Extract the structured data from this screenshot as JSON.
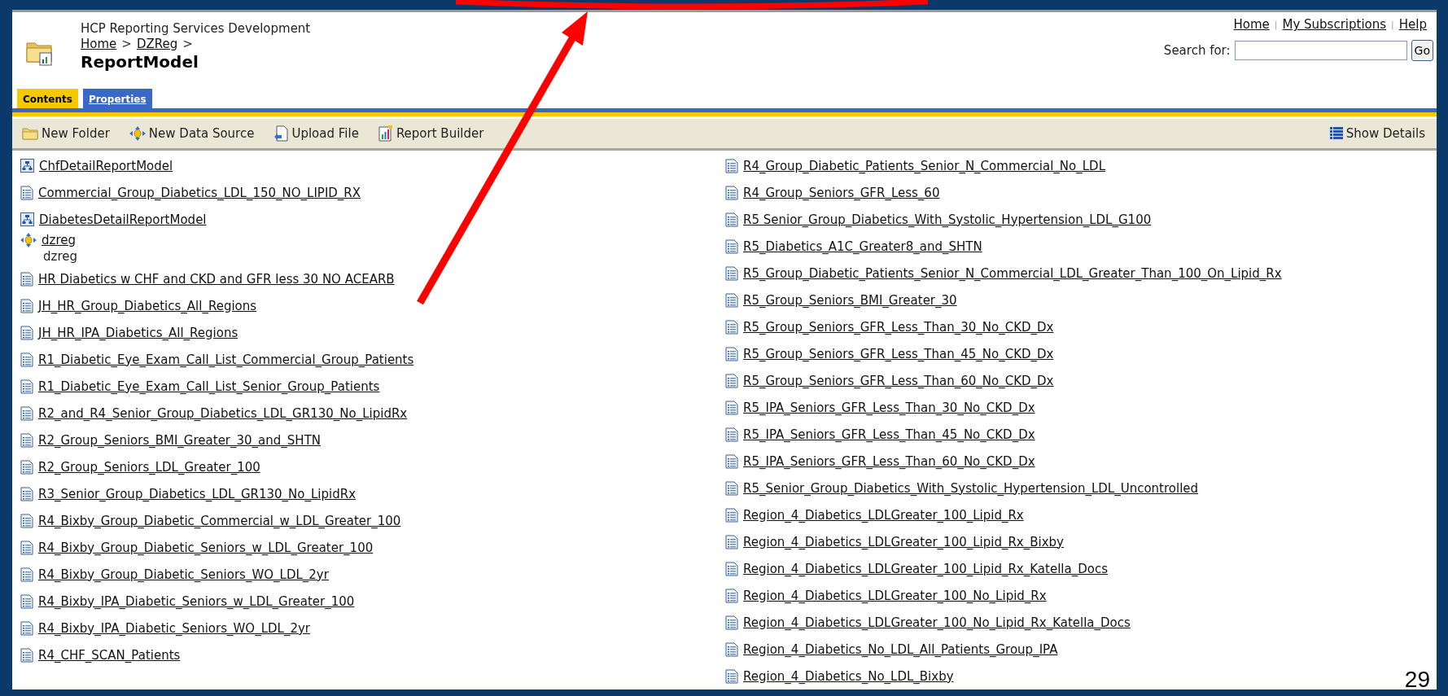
{
  "header": {
    "site_title": "HCP Reporting Services Development",
    "breadcrumb": [
      {
        "label": "Home",
        "separator": ">"
      },
      {
        "label": "DZReg",
        "separator": ">"
      }
    ],
    "page_title": "ReportModel"
  },
  "top_links": [
    {
      "label": "Home",
      "separator": "|"
    },
    {
      "label": "My Subscriptions",
      "separator": "|"
    },
    {
      "label": "Help"
    }
  ],
  "search": {
    "label": "Search for:",
    "button": "Go"
  },
  "tabs": [
    {
      "label": "Contents",
      "selected": true
    },
    {
      "label": "Properties",
      "selected": false
    }
  ],
  "toolbar": {
    "actions": [
      {
        "label": "New Folder",
        "kind": "folder"
      },
      {
        "label": "New Data Source",
        "kind": "datasource"
      },
      {
        "label": "Upload File",
        "kind": "upload"
      },
      {
        "label": "Report Builder",
        "kind": "builder"
      }
    ],
    "show_details": "Show Details"
  },
  "left_column": [
    {
      "name": "ChfDetailReportModel",
      "kind": "model"
    },
    {
      "name": "Commercial_Group_Diabetics_LDL_150_NO_LIPID_RX",
      "kind": "report"
    },
    {
      "name": "DiabetesDetailReportModel",
      "kind": "model"
    },
    {
      "name": "dzreg",
      "kind": "datasource",
      "description": "dzreg"
    },
    {
      "name": "HR Diabetics w CHF and CKD and GFR less 30 NO ACEARB",
      "kind": "report"
    },
    {
      "name": "JH_HR_Group_Diabetics_All_Regions",
      "kind": "report"
    },
    {
      "name": "JH_HR_IPA_Diabetics_All_Regions",
      "kind": "report"
    },
    {
      "name": "R1_Diabetic_Eye_Exam_Call_List_Commercial_Group_Patients",
      "kind": "report"
    },
    {
      "name": "R1_Diabetic_Eye_Exam_Call_List_Senior_Group_Patients",
      "kind": "report"
    },
    {
      "name": "R2_and_R4_Senior_Group_Diabetics_LDL_GR130_No_LipidRx",
      "kind": "report"
    },
    {
      "name": "R2_Group_Seniors_BMI_Greater_30_and_SHTN",
      "kind": "report"
    },
    {
      "name": "R2_Group_Seniors_LDL_Greater_100",
      "kind": "report"
    },
    {
      "name": "R3_Senior_Group_Diabetics_LDL_GR130_No_LipidRx",
      "kind": "report"
    },
    {
      "name": "R4_Bixby_Group_Diabetic_Commercial_w_LDL_Greater_100",
      "kind": "report"
    },
    {
      "name": "R4_Bixby_Group_Diabetic_Seniors_w_LDL_Greater_100",
      "kind": "report"
    },
    {
      "name": "R4_Bixby_Group_Diabetic_Seniors_WO_LDL_2yr",
      "kind": "report"
    },
    {
      "name": "R4_Bixby_IPA_Diabetic_Seniors_w_LDL_Greater_100",
      "kind": "report"
    },
    {
      "name": "R4_Bixby_IPA_Diabetic_Seniors_WO_LDL_2yr",
      "kind": "report"
    },
    {
      "name": "R4_CHF_SCAN_Patients",
      "kind": "report"
    }
  ],
  "right_column": [
    {
      "name": "R4_Group_Diabetic_Patients_Senior_N_Commercial_No_LDL",
      "kind": "report"
    },
    {
      "name": "R4_Group_Seniors_GFR_Less_60",
      "kind": "report"
    },
    {
      "name": "R5 Senior_Group_Diabetics_With_Systolic_Hypertension_LDL_G100",
      "kind": "report"
    },
    {
      "name": "R5_Diabetics_A1C_Greater8_and_SHTN",
      "kind": "report"
    },
    {
      "name": "R5_Group_Diabetic_Patients_Senior_N_Commercial_LDL_Greater_Than_100_On_Lipid_Rx",
      "kind": "report"
    },
    {
      "name": "R5_Group_Seniors_BMI_Greater_30",
      "kind": "report"
    },
    {
      "name": "R5_Group_Seniors_GFR_Less_Than_30_No_CKD_Dx",
      "kind": "report"
    },
    {
      "name": "R5_Group_Seniors_GFR_Less_Than_45_No_CKD_Dx",
      "kind": "report"
    },
    {
      "name": "R5_Group_Seniors_GFR_Less_Than_60_No_CKD_Dx",
      "kind": "report"
    },
    {
      "name": "R5_IPA_Seniors_GFR_Less_Than_30_No_CKD_Dx",
      "kind": "report"
    },
    {
      "name": "R5_IPA_Seniors_GFR_Less_Than_45_No_CKD_Dx",
      "kind": "report"
    },
    {
      "name": "R5_IPA_Seniors_GFR_Less_Than_60_No_CKD_Dx",
      "kind": "report"
    },
    {
      "name": "R5_Senior_Group_Diabetics_With_Systolic_Hypertension_LDL_Uncontrolled",
      "kind": "report"
    },
    {
      "name": "Region_4_Diabetics_LDLGreater_100_Lipid_Rx",
      "kind": "report"
    },
    {
      "name": "Region_4_Diabetics_LDLGreater_100_Lipid_Rx_Bixby",
      "kind": "report"
    },
    {
      "name": "Region_4_Diabetics_LDLGreater_100_Lipid_Rx_Katella_Docs",
      "kind": "report"
    },
    {
      "name": "Region_4_Diabetics_LDLGreater_100_No_Lipid_Rx",
      "kind": "report"
    },
    {
      "name": "Region_4_Diabetics_LDLGreater_100_No_Lipid_Rx_Katella_Docs",
      "kind": "report"
    },
    {
      "name": "Region_4_Diabetics_No_LDL_All_Patients_Group_IPA",
      "kind": "report"
    },
    {
      "name": "Region_4_Diabetics_No_LDL_Bixby",
      "kind": "report"
    }
  ],
  "slide_number": "29"
}
